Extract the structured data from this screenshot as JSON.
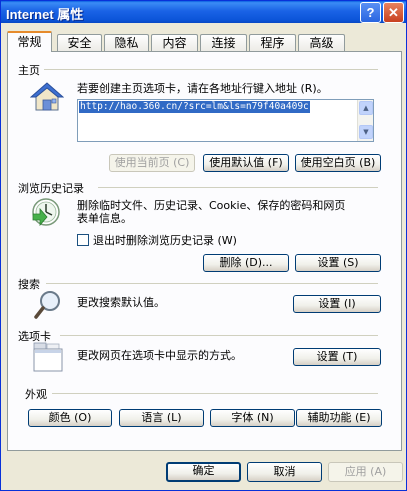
{
  "window": {
    "title": "Internet 属性",
    "help_glyph": "?",
    "close_glyph": "✕"
  },
  "tabs": [
    "常规",
    "安全",
    "隐私",
    "内容",
    "连接",
    "程序",
    "高级"
  ],
  "homepage": {
    "section_label": "主页",
    "description": "若要创建主页选项卡，请在各地址行键入地址 (R)。",
    "url": "http://hao.360.cn/?src=lm&ls=n79f40a409c",
    "use_current_label": "使用当前页 (C)",
    "use_default_label": "使用默认值 (F)",
    "use_blank_label": "使用空白页 (B)"
  },
  "history": {
    "section_label": "浏览历史记录",
    "description_line1": "删除临时文件、历史记录、Cookie、保存的密码和网页",
    "description_line2": "表单信息。",
    "checkbox_label": "退出时删除浏览历史记录 (W)",
    "checkbox_checked": false,
    "delete_label": "删除 (D)...",
    "settings_label": "设置 (S)"
  },
  "search": {
    "section_label": "搜索",
    "description": "更改搜索默认值。",
    "settings_label": "设置 (I)"
  },
  "tabs_section": {
    "section_label": "选项卡",
    "description": "更改网页在选项卡中显示的方式。",
    "settings_label": "设置 (T)"
  },
  "appearance": {
    "section_label": "外观",
    "colors_label": "颜色 (O)",
    "languages_label": "语言 (L)",
    "fonts_label": "字体 (N)",
    "accessibility_label": "辅助功能 (E)"
  },
  "dialog_buttons": {
    "ok_label": "确定",
    "cancel_label": "取消",
    "apply_label": "应用 (A)"
  },
  "colors": {
    "titlebar": "#0c55d9",
    "active_tab_accent": "#e68b2c",
    "url_selection": "#316ac5",
    "button_border": "#003c74"
  }
}
